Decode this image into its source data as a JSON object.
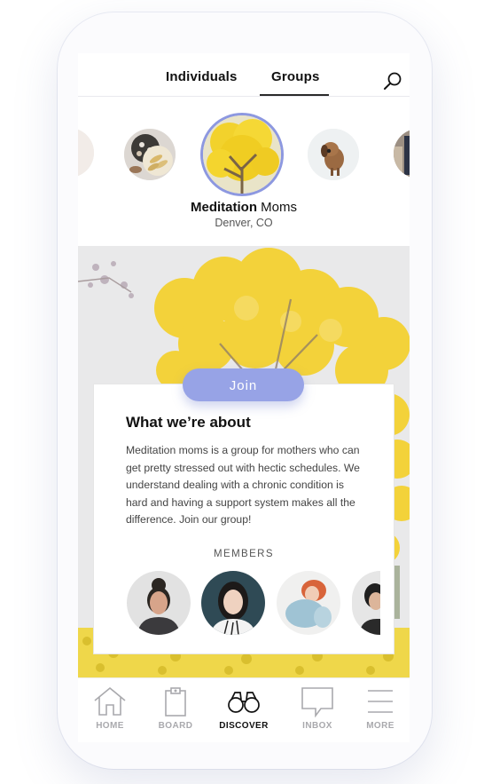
{
  "tabs": {
    "individuals": "Individuals",
    "groups": "Groups",
    "active": "Groups"
  },
  "group": {
    "name_bold": "Meditation",
    "name_rest": " Moms",
    "location": "Denver, CO"
  },
  "join_label": "Join",
  "about": {
    "title": "What we’re about",
    "text": "Meditation moms is a group for mothers who can get pretty stressed out with hectic schedules. We understand dealing with a chronic condition is hard and having a support system makes all the difference. Join our group!"
  },
  "members_label": "MEMBERS",
  "nav": [
    {
      "label": "HOME",
      "icon": "home-icon"
    },
    {
      "label": "BOARD",
      "icon": "clipboard-icon"
    },
    {
      "label": "DISCOVER",
      "icon": "binoculars-icon",
      "active": true
    },
    {
      "label": "INBOX",
      "icon": "chat-bubble-icon"
    },
    {
      "label": "MORE",
      "icon": "menu-icon"
    }
  ],
  "colors": {
    "accent": "#97a3e6",
    "ring": "#8d98e0",
    "tree_yellow": "#f2d22c"
  }
}
